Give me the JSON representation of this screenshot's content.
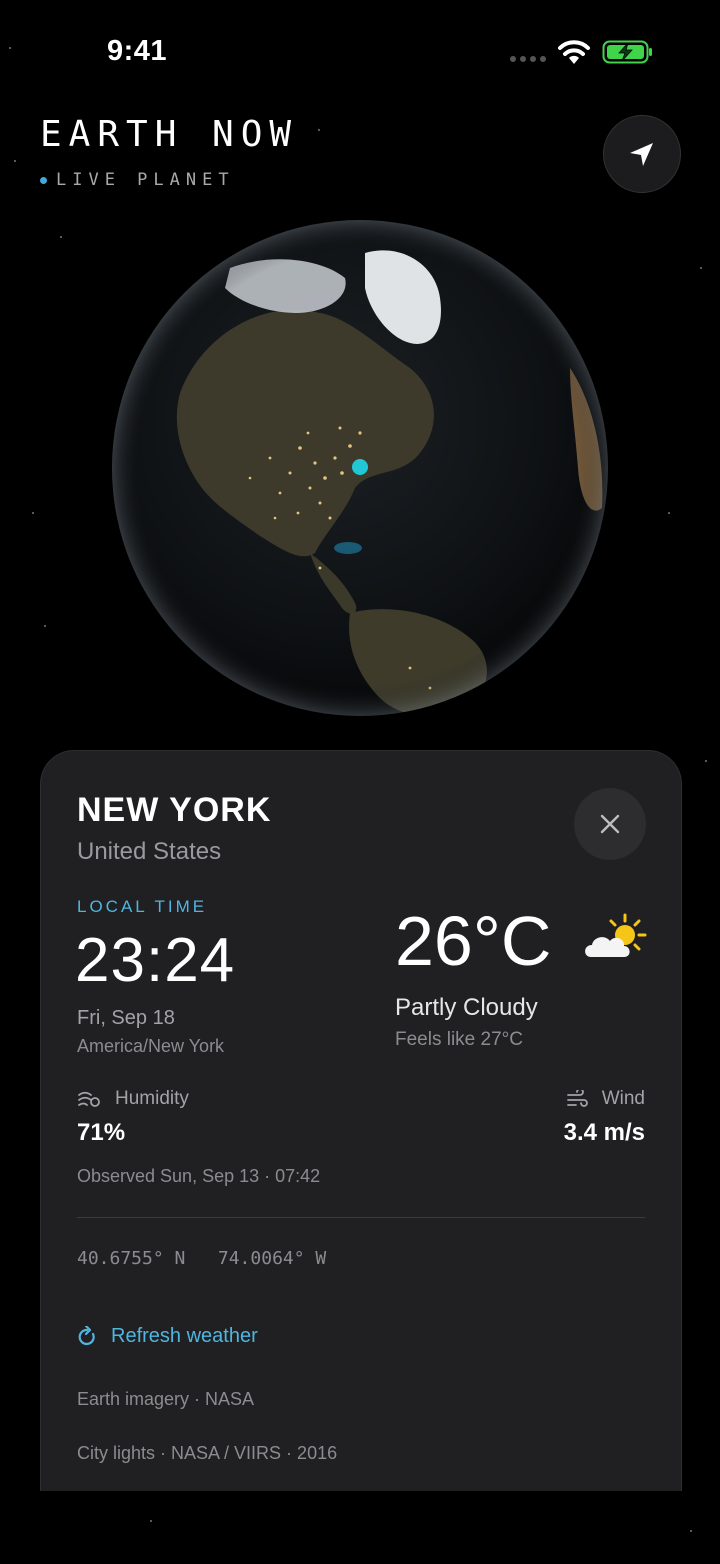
{
  "status_bar": {
    "time": "9:41"
  },
  "header": {
    "title": "EARTH NOW",
    "subtitle": "LIVE PLANET"
  },
  "card": {
    "city": "NEW YORK",
    "country": "United States",
    "local_time_label": "LOCAL TIME",
    "local_time": "23:24",
    "date": "Fri, Sep 18",
    "timezone": "America/New York",
    "temperature": "26°C",
    "condition": "Partly Cloudy",
    "feels_like": "Feels like 27°C",
    "humidity_label": "Humidity",
    "humidity_value": "71%",
    "wind_label": "Wind",
    "wind_value": "3.4 m/s",
    "observed": "Observed Sun, Sep 13 · 07:42",
    "coordinates": "40.6755° N   74.0064° W",
    "refresh_label": "Refresh weather",
    "credit_imagery": "Earth imagery · NASA",
    "credit_lights": "City lights · NASA / VIIRS · 2016"
  },
  "colors": {
    "accent": "#4fb5e0",
    "marker": "#22c7d6",
    "card_bg": "#202022"
  },
  "icons": {
    "locate": "location-arrow-icon",
    "close": "close-icon",
    "weather": "partly-cloudy-icon",
    "humidity": "humidity-icon",
    "wind": "wind-icon",
    "refresh": "refresh-icon"
  }
}
